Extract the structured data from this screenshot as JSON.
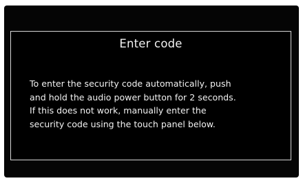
{
  "dialog": {
    "title": "Enter code",
    "message_lines": [
      "To enter the security code automatically, push",
      "and hold the audio power button for 2 seconds.",
      "If this does not work, manually enter the",
      "security code using the touch panel below."
    ]
  },
  "colors": {
    "screen_background": "#050505",
    "dialog_border": "#d8d8d8",
    "text": "#f2f2f2"
  }
}
